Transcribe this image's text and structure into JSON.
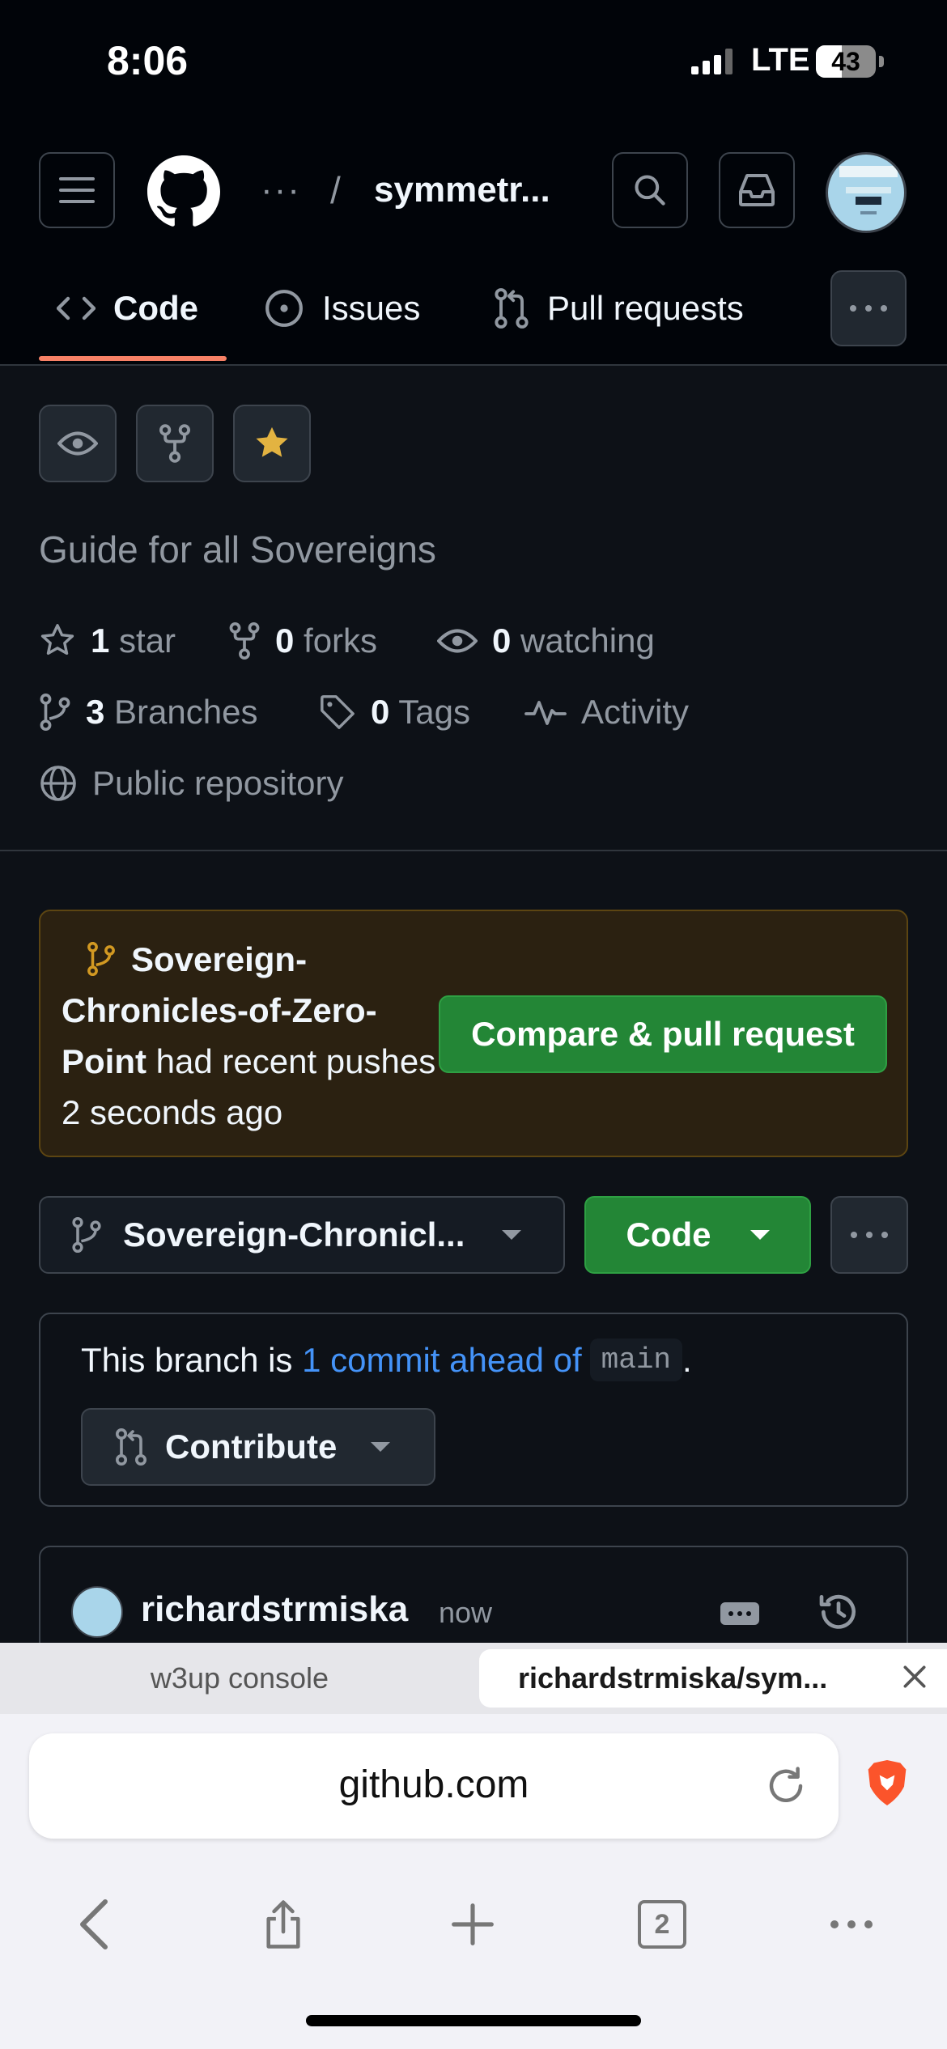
{
  "status_bar": {
    "time": "8:06",
    "network": "LTE",
    "battery": "43",
    "battery_level": 0.43
  },
  "header": {
    "breadcrumb_ellipsis": "···",
    "breadcrumb_separator": "/",
    "repo_name": "symmetr..."
  },
  "tabs": [
    {
      "label": "Code",
      "icon": "code-icon",
      "active": true
    },
    {
      "label": "Issues",
      "icon": "issue-icon"
    },
    {
      "label": "Pull requests",
      "icon": "pull-request-icon"
    }
  ],
  "repo": {
    "description": "Guide for all Sovereigns",
    "stars_count": "1",
    "stars_label": "star",
    "forks_count": "0",
    "forks_label": "forks",
    "watching_count": "0",
    "watching_label": "watching",
    "branches_count": "3",
    "branches_label": "Branches",
    "tags_count": "0",
    "tags_label": "Tags",
    "activity_label": "Activity",
    "visibility": "Public repository"
  },
  "push_banner": {
    "branch": "Sovereign-Chronicles-of-Zero-Point",
    "message": " had recent pushes 2 seconds ago",
    "button": "Compare & pull request"
  },
  "branch_bar": {
    "branch": "Sovereign-Chronicl...",
    "code_button": "Code"
  },
  "ahead": {
    "prefix": "This branch is ",
    "link": "1 commit ahead of",
    "base": "main",
    "suffix": ".",
    "contribute": "Contribute"
  },
  "commit": {
    "author": "richardstrmiska",
    "time": "now"
  },
  "browser": {
    "tabs": [
      {
        "title": "w3up console"
      },
      {
        "title": "richardstrmiska/sym...",
        "active": true
      }
    ],
    "url": "github.com",
    "tab_count": "2"
  },
  "colors": {
    "accent_green": "#238636",
    "link_blue": "#4493f8",
    "tab_underline": "#f78166",
    "star_yellow": "#e3b341"
  }
}
